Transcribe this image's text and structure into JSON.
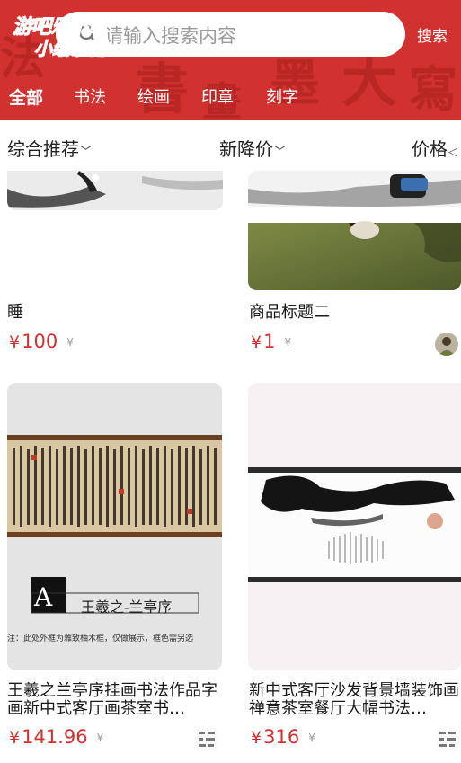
{
  "watermark": {
    "line1": "游吧乐下载",
    "line2": "小编亲测"
  },
  "search": {
    "placeholder": "请输入搜索内容",
    "button_label": "搜索"
  },
  "tabs": [
    {
      "label": "全部",
      "active": true
    },
    {
      "label": "书法"
    },
    {
      "label": "绘画"
    },
    {
      "label": "印章"
    },
    {
      "label": "刻字"
    }
  ],
  "sort": [
    {
      "label": "综合推荐",
      "chevron": "chevron-down-icon"
    },
    {
      "label": "新降价",
      "chevron": "chevron-down-icon"
    },
    {
      "label": "价格",
      "chevron": "sort-icon"
    }
  ],
  "products": [
    {
      "title": "睡",
      "price": "100",
      "currency": "¥",
      "old_price": "¥"
    },
    {
      "title": "商品标题二",
      "price": "1",
      "currency": "¥",
      "old_price": "¥"
    },
    {
      "title": "王羲之兰亭序挂画书法作品字画新中式客厅画茶室书…",
      "price": "141.96",
      "currency": "¥",
      "old_price": "¥",
      "image_caption_mark": "A",
      "image_caption": "王羲之-兰亭序",
      "image_note": "注：此处外框为雅致柚木框，仅做展示，框色需另选"
    },
    {
      "title": "新中式客厅沙发背景墙装饰画禅意茶室餐厅大幅书法…",
      "price": "316",
      "currency": "¥",
      "old_price": "¥"
    }
  ],
  "colors": {
    "brand": "#d1322f",
    "watermark": "#3fc8f5"
  }
}
